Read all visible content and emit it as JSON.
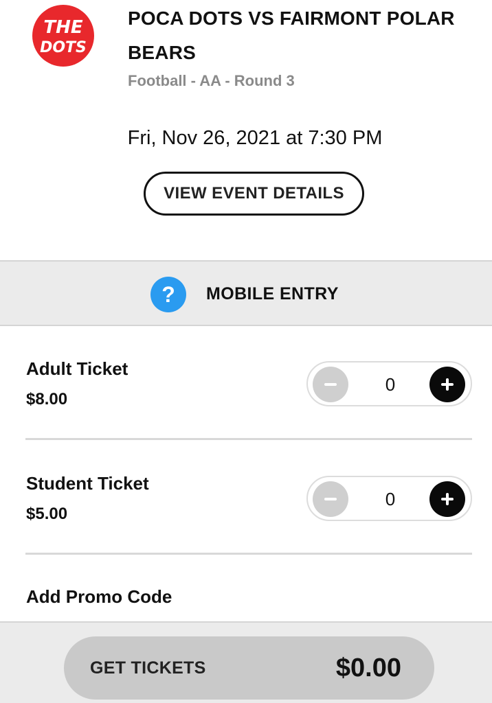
{
  "event": {
    "logo_text_top": "THE",
    "logo_text_bottom": "DOTS",
    "logo_color": "#e8282c",
    "title": "POCA DOTS VS FAIRMONT POLAR BEARS",
    "subtitle": "Football - AA - Round 3",
    "datetime": "Fri, Nov 26, 2021 at 7:30 PM",
    "details_button_label": "VIEW EVENT DETAILS"
  },
  "mobile_entry": {
    "icon": "question-icon",
    "icon_glyph": "?",
    "icon_color": "#2a9bf0",
    "label": "MOBILE ENTRY"
  },
  "tickets": [
    {
      "name": "Adult Ticket",
      "price": "$8.00",
      "quantity": "0"
    },
    {
      "name": "Student Ticket",
      "price": "$5.00",
      "quantity": "0"
    }
  ],
  "promo": {
    "label": "Add Promo Code"
  },
  "footer": {
    "button_label": "GET TICKETS",
    "total": "$0.00"
  }
}
